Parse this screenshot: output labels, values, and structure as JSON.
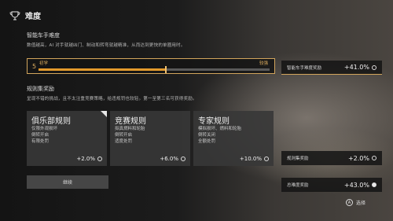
{
  "header": {
    "title": "难度",
    "icon": "trophy-icon"
  },
  "difficulty": {
    "section_title": "智能车手难度",
    "description": "数值越高，AI 对手就越凶门、制动和转弯就越精准，从而达到更快的单圈用时。",
    "level": "5",
    "left_label": "初学",
    "right_label": "较强",
    "progress_percent": 55
  },
  "rules": {
    "section_title": "规则集奖励",
    "description": "呈现不错的挑战，且不太注重竞赛策略，给违规罚也较轻。第一至第三名可获得奖励。",
    "cards": [
      {
        "name": "俱乐部规则",
        "lines": [
          "仅限外观损坏",
          "倒转开启",
          "有限处罚"
        ],
        "bonus": "+2.0%",
        "selected": true
      },
      {
        "name": "竞赛规则",
        "lines": [
          "拟真燃料和轮胎",
          "倒转开启",
          "适度处罚"
        ],
        "bonus": "+6.0%",
        "selected": false
      },
      {
        "name": "专家规则",
        "lines": [
          "模拟损坏、燃料和轮胎",
          "倒转关闭",
          "全额处罚"
        ],
        "bonus": "+10.0%",
        "selected": false
      }
    ]
  },
  "continue_label": "继续",
  "rewards": {
    "ai_label": "智能车手难度奖励",
    "ai_value": "+41.0%",
    "rules_label": "规则集奖励",
    "rules_value": "+2.0%",
    "total_label": "总难度奖励",
    "total_value": "+43.0%"
  },
  "footer": {
    "select_label": "选择",
    "button_glyph": "A"
  },
  "colors": {
    "accent": "#e39a2c",
    "border": "#d2a55c"
  }
}
